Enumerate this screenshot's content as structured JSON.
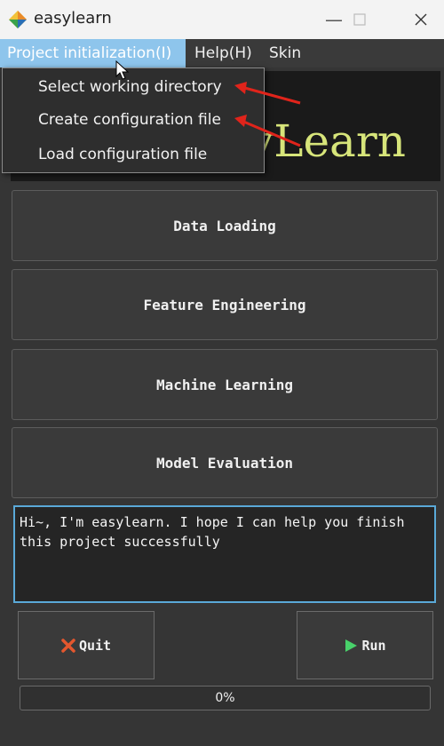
{
  "window": {
    "title": "easylearn"
  },
  "menubar": {
    "items": [
      {
        "label": "Project initialization(I)"
      },
      {
        "label": "Help(H)"
      },
      {
        "label": "Skin"
      }
    ]
  },
  "dropdown": {
    "items": [
      {
        "label": "Select working directory"
      },
      {
        "label": "Create configuration file"
      },
      {
        "label": "Load configuration file"
      }
    ]
  },
  "banner": {
    "text": "yLearn"
  },
  "main": {
    "buttons": [
      {
        "label": "Data Loading"
      },
      {
        "label": "Feature Engineering"
      },
      {
        "label": "Machine Learning"
      },
      {
        "label": "Model Evaluation"
      }
    ],
    "message": "Hi~, I'm easylearn. I hope I can help you finish\nthis project successfully"
  },
  "footer": {
    "quit_label": "Quit",
    "run_label": "Run",
    "progress_text": "0%",
    "progress_value": 0
  },
  "colors": {
    "accent": "#5aa9d8",
    "menu_active": "#8ec5ec",
    "annotation_arrow": "#e0241b"
  }
}
